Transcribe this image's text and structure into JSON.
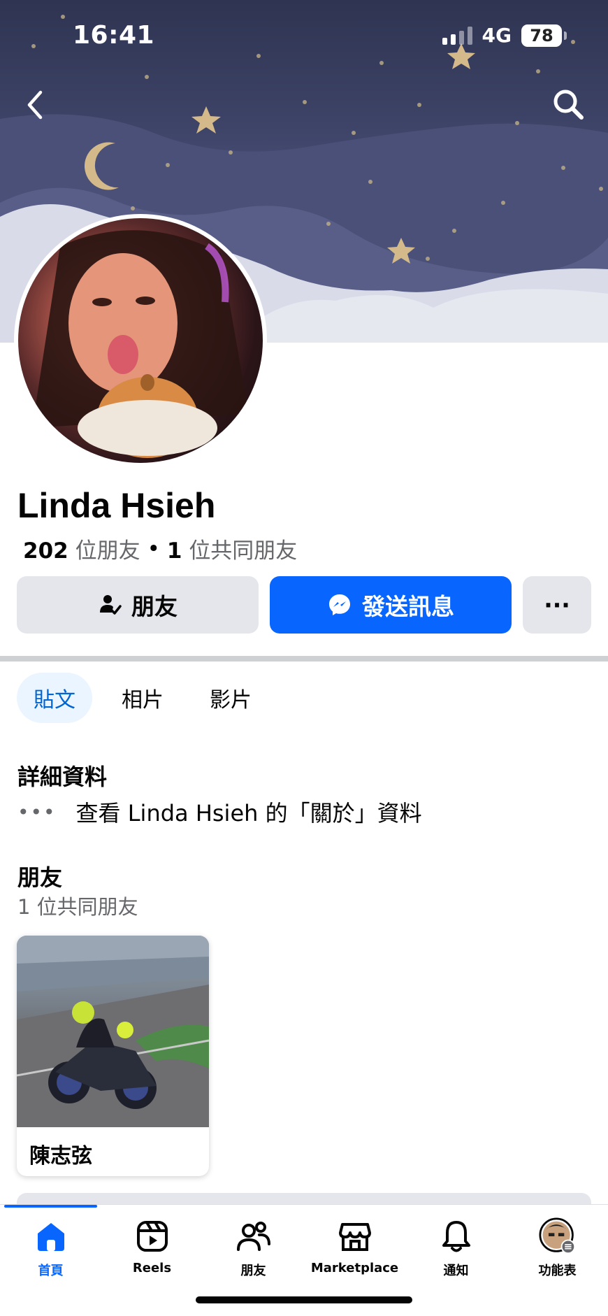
{
  "status_bar": {
    "time": "16:41",
    "network": "4G",
    "battery": "78"
  },
  "profile": {
    "name": "Linda Hsieh",
    "friend_count": "202",
    "friend_count_suffix": "位朋友",
    "separator": "•",
    "mutual_count": "1",
    "mutual_suffix": "位共同朋友"
  },
  "actions": {
    "friends_label": "朋友",
    "message_label": "發送訊息",
    "more_label": "···"
  },
  "tabs": [
    {
      "label": "貼文",
      "active": true
    },
    {
      "label": "相片",
      "active": false
    },
    {
      "label": "影片",
      "active": false
    }
  ],
  "details": {
    "title": "詳細資料",
    "about_dots": "•••",
    "about_text": "查看 Linda Hsieh 的「關於」資料"
  },
  "friends_section": {
    "title": "朋友",
    "subtitle": "1 位共同朋友",
    "cards": [
      {
        "name": "陳志弦"
      }
    ]
  },
  "bottom_nav": [
    {
      "label": "首頁",
      "icon": "home-icon",
      "active": true
    },
    {
      "label": "Reels",
      "icon": "reels-icon",
      "active": false
    },
    {
      "label": "朋友",
      "icon": "friends-icon",
      "active": false
    },
    {
      "label": "Marketplace",
      "icon": "marketplace-icon",
      "active": false
    },
    {
      "label": "通知",
      "icon": "bell-icon",
      "active": false
    },
    {
      "label": "功能表",
      "icon": "menu-avatar-icon",
      "active": false
    }
  ],
  "colors": {
    "brand_blue": "#0866ff",
    "secondary_button": "#e4e6eb",
    "muted_text": "#65676b",
    "active_tab_bg": "#ebf5ff"
  }
}
